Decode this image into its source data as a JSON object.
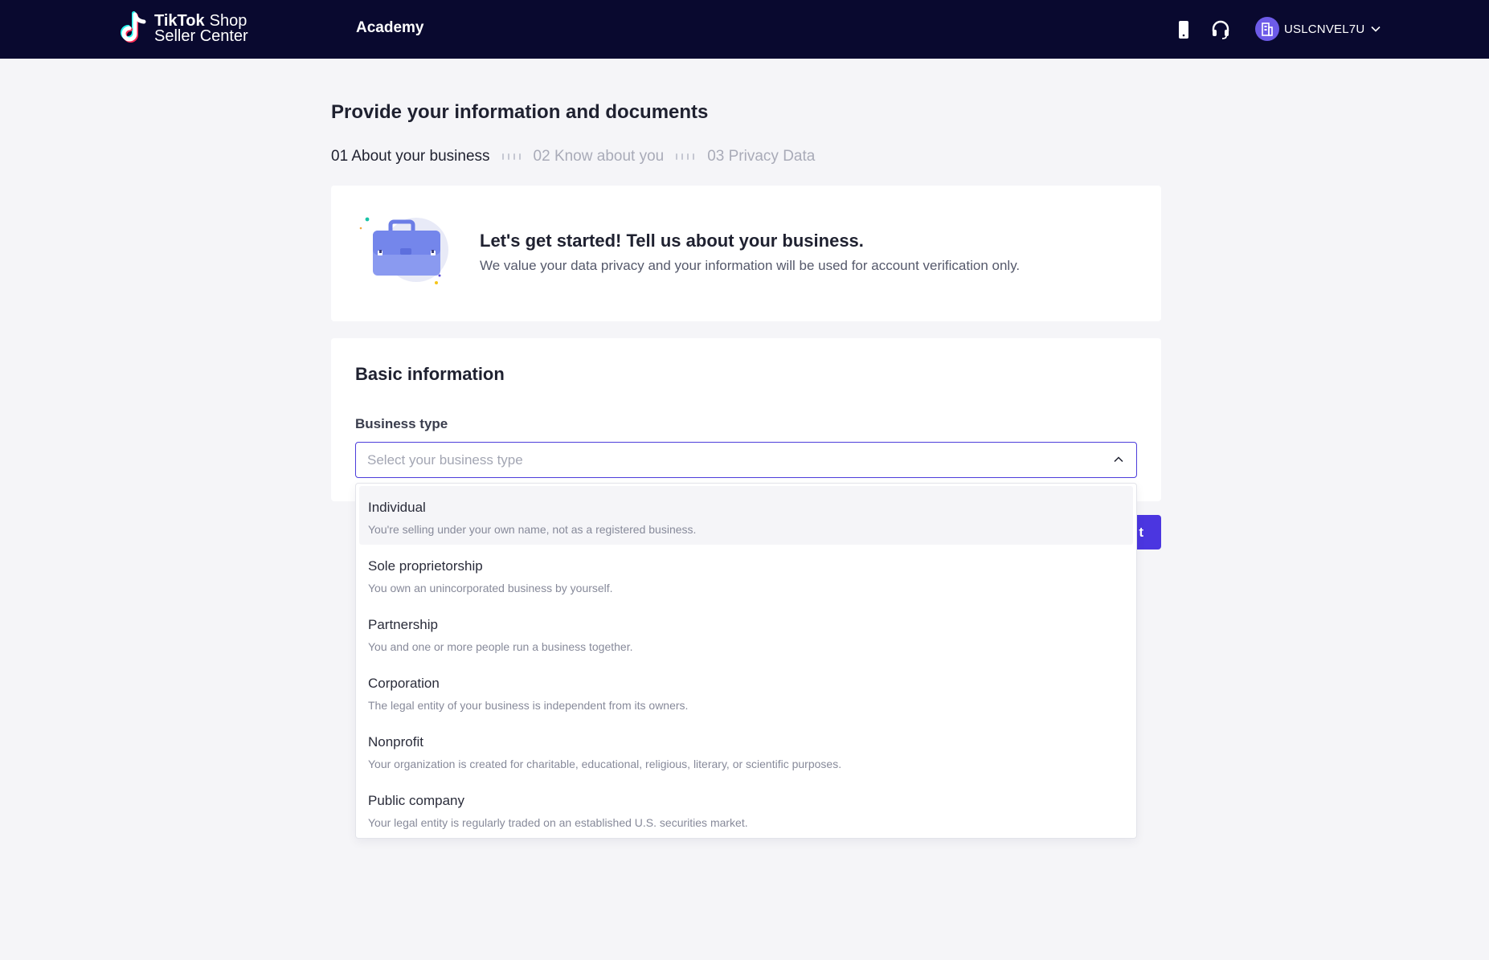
{
  "header": {
    "logo_word_1": "TikTok",
    "logo_word_2": "Shop",
    "logo_line_2": "Seller Center",
    "nav_academy": "Academy",
    "account_name": "USLCNVEL7U",
    "icons": [
      "mobile-icon",
      "headset-icon",
      "building-icon",
      "chevron-down-icon"
    ]
  },
  "page": {
    "title": "Provide your information and documents",
    "steps": [
      {
        "label": "01 About your business",
        "state": "active"
      },
      {
        "label": "02 Know about you",
        "state": "inactive"
      },
      {
        "label": "03 Privacy Data",
        "state": "inactive"
      }
    ]
  },
  "intro": {
    "title": "Let's get started! Tell us about your business.",
    "subtitle": "We value your data privacy and your information will be used for account verification only.",
    "icon": "briefcase-icon"
  },
  "basic_info": {
    "section_title": "Basic information",
    "business_type_label": "Business type",
    "business_type_placeholder": "Select your business type",
    "options": [
      {
        "title": "Individual",
        "desc": "You're selling under your own name, not as a registered business."
      },
      {
        "title": "Sole proprietorship",
        "desc": "You own an unincorporated business by yourself."
      },
      {
        "title": "Partnership",
        "desc": "You and one or more people run a business together."
      },
      {
        "title": "Corporation",
        "desc": "The legal entity of your business is independent from its owners."
      },
      {
        "title": "Nonprofit",
        "desc": "Your organization is created for charitable, educational, religious, literary, or scientific purposes."
      },
      {
        "title": "Public company",
        "desc": "Your legal entity is regularly traded on an established U.S. securities market."
      }
    ]
  },
  "actions": {
    "next_visible_text": "t"
  },
  "colors": {
    "topbar": "#09092f",
    "accent": "#4b36e0",
    "page_bg": "#f5f5f8",
    "avatar": "#6d5be8"
  }
}
